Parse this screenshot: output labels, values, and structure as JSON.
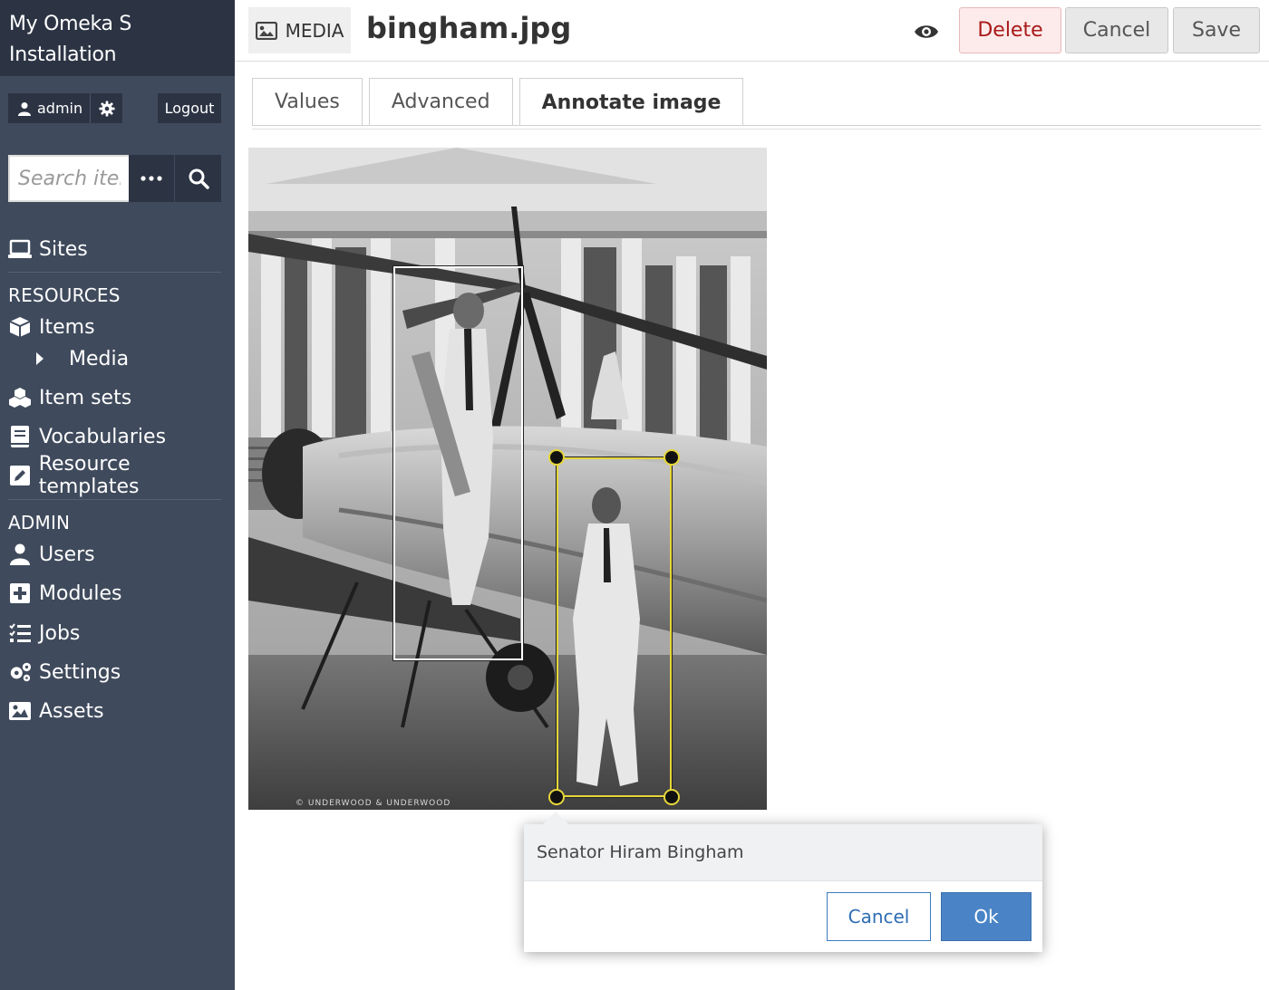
{
  "brand": {
    "title_line1": "My Omeka S",
    "title_line2": "Installation"
  },
  "user": {
    "name": "admin",
    "logout_label": "Logout"
  },
  "search": {
    "placeholder": "Search items"
  },
  "nav": {
    "sites": "Sites",
    "resources_heading": "RESOURCES",
    "items": "Items",
    "media": "Media",
    "item_sets": "Item sets",
    "vocabularies": "Vocabularies",
    "resource_templates": "Resource templates",
    "admin_heading": "ADMIN",
    "users": "Users",
    "modules": "Modules",
    "jobs": "Jobs",
    "settings": "Settings",
    "assets": "Assets"
  },
  "header": {
    "badge": "MEDIA",
    "title": "bingham.jpg",
    "delete_label": "Delete",
    "cancel_label": "Cancel",
    "save_label": "Save"
  },
  "tabs": [
    {
      "label": "Values",
      "active": false
    },
    {
      "label": "Advanced",
      "active": false
    },
    {
      "label": "Annotate image",
      "active": true
    }
  ],
  "photo": {
    "credit": "© UNDERWOOD & UNDERWOOD"
  },
  "popup": {
    "annotation_text": "Senator Hiram Bingham",
    "cancel_label": "Cancel",
    "ok_label": "Ok"
  },
  "colors": {
    "sidebar": "#3f4a5c",
    "sidebar_dark": "#2c3444",
    "delete_text": "#a91919",
    "ok_button": "#4a84c6",
    "annotation_selected": "#e6d63a"
  }
}
